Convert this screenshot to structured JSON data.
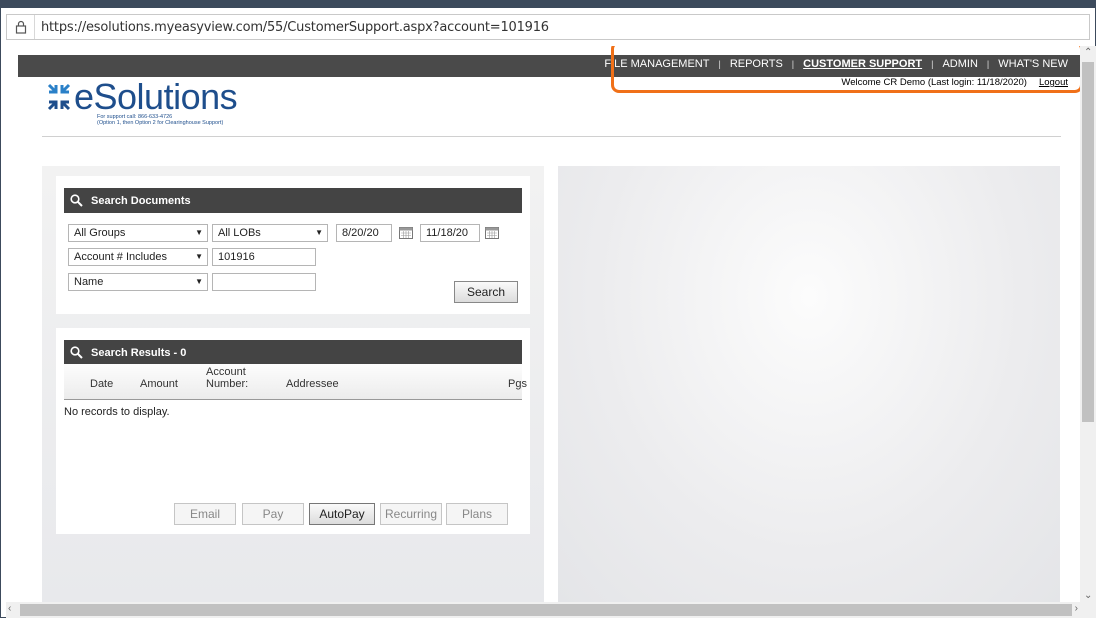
{
  "browser": {
    "url": "https://esolutions.myeasyview.com/55/CustomerSupport.aspx?account=101916"
  },
  "nav": {
    "items": [
      "FILE MANAGEMENT",
      "REPORTS",
      "CUSTOMER SUPPORT",
      "ADMIN",
      "WHAT'S NEW"
    ],
    "separator": "|",
    "active": "CUSTOMER SUPPORT"
  },
  "welcome": {
    "text": "Welcome CR Demo (Last login: 11/18/2020)",
    "logout": "Logout"
  },
  "logo": {
    "name": "eSolutions",
    "support_line1": "For support call: 866-633-4726",
    "support_line2": "(Option 1, then Option 2 for Clearinghouse Support)"
  },
  "search": {
    "title": "Search Documents",
    "group_select": "All Groups",
    "lob_select": "All LOBs",
    "date_from": "8/20/20",
    "date_to": "11/18/20",
    "field_select": "Account # Includes",
    "field_value": "101916",
    "field2_select": "Name",
    "field2_value": "",
    "search_button": "Search"
  },
  "results": {
    "title": "Search Results - 0",
    "columns": {
      "date": "Date",
      "amount": "Amount",
      "account_l1": "Account",
      "account_l2": "Number:",
      "addressee": "Addressee",
      "pgs": "Pgs"
    },
    "empty": "No records to display.",
    "buttons": {
      "email": "Email",
      "pay": "Pay",
      "autopay": "AutoPay",
      "recurring": "Recurring",
      "plans": "Plans"
    }
  },
  "colors": {
    "highlight": "#f07018",
    "nav_bar": "#4a4a4a",
    "brand": "#1e4e8c"
  }
}
